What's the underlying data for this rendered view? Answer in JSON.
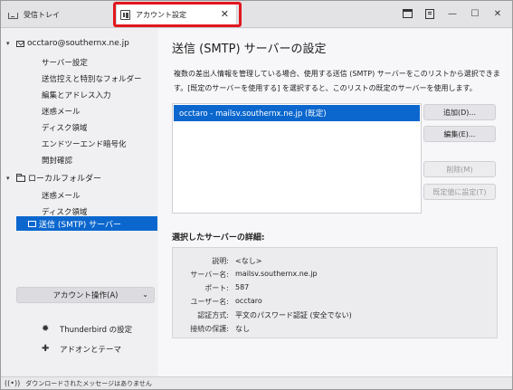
{
  "tabs": {
    "inbox_label": "受信トレイ",
    "account_label": "アカウント設定",
    "close_glyph": "✕"
  },
  "window_controls": {
    "minimize": "—",
    "maximize": "☐",
    "close": "✕"
  },
  "sidebar": {
    "account": "occtaro@southernx.ne.jp",
    "account_items": [
      "サーバー設定",
      "送信控えと特別なフォルダー",
      "編集とアドレス入力",
      "迷惑メール",
      "ディスク領域",
      "エンドツーエンド暗号化",
      "開封確認"
    ],
    "local_folder": "ローカルフォルダー",
    "local_items": [
      "迷惑メール",
      "ディスク領域"
    ],
    "selected_item": "送信 (SMTP) サーバー",
    "account_ops": "アカウント操作(A)",
    "settings_link": "Thunderbird の設定",
    "addons_link": "アドオンとテーマ"
  },
  "main": {
    "title": "送信 (SMTP) サーバーの設定",
    "desc_line1": "複数の差出人情報を管理している場合、使用する送信 (SMTP) サーバーをこのリストから選択できま",
    "desc_line2": "す。[既定のサーバーを使用する] を選択すると、このリストの既定のサーバーを使用します。",
    "servers": [
      "occtaro - mailsv.southernx.ne.jp (既定)"
    ],
    "buttons": {
      "add": "追加(D)...",
      "edit": "編集(E)...",
      "delete": "削除(M)",
      "set_default": "既定値に設定(T)"
    },
    "details_title": "選択したサーバーの詳細:",
    "details": [
      {
        "label": "説明:",
        "value": "<なし>"
      },
      {
        "label": "サーバー名:",
        "value": "mailsv.southernx.ne.jp"
      },
      {
        "label": "ポート:",
        "value": "587"
      },
      {
        "label": "ユーザー名:",
        "value": "occtaro"
      },
      {
        "label": "認証方式:",
        "value": "平文のパスワード認証 (安全でない)"
      },
      {
        "label": "接続の保護:",
        "value": "なし"
      }
    ]
  },
  "status": {
    "message": "ダウンロードされたメッセージはありません"
  }
}
